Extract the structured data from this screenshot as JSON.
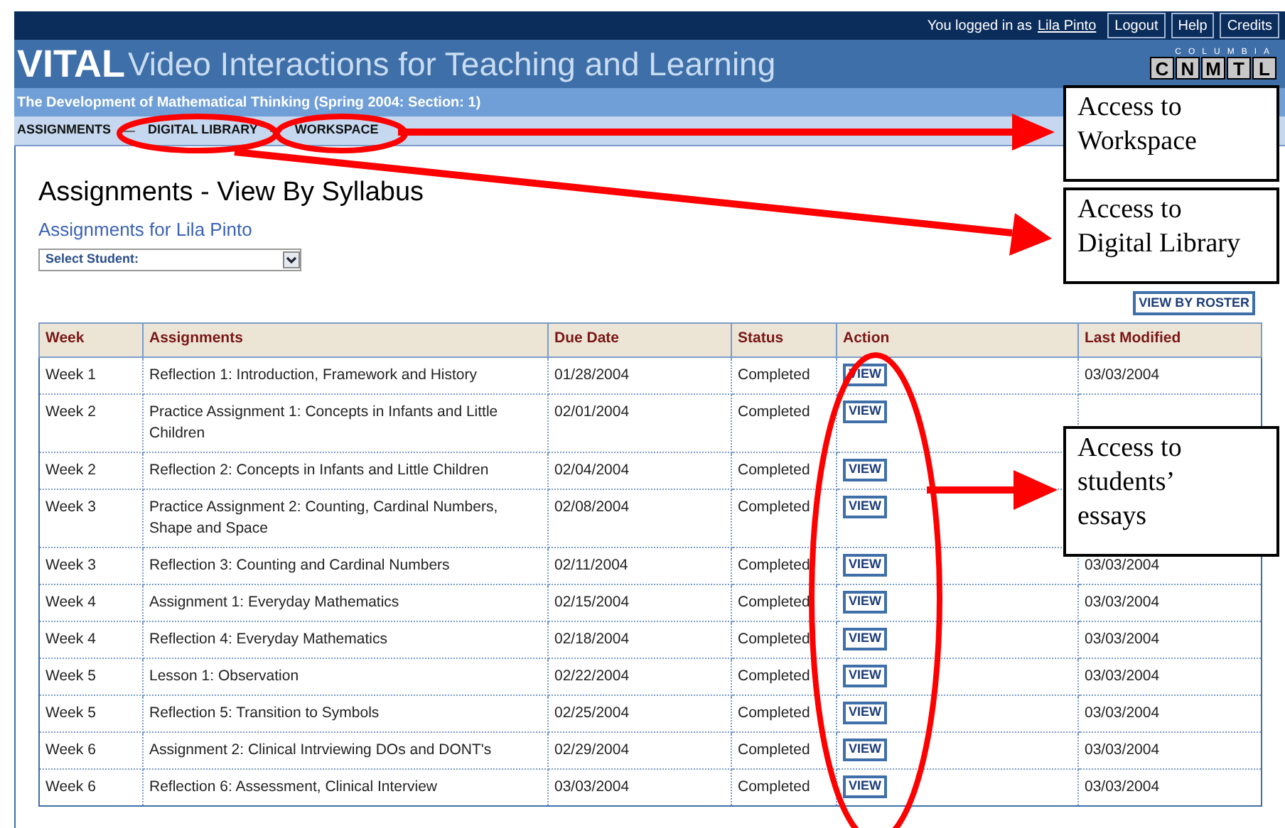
{
  "top_bar": {
    "login_text": "You logged in as",
    "user_link": "Lila Pinto",
    "buttons": [
      "Logout",
      "Help",
      "Credits"
    ]
  },
  "header": {
    "brand": "VITAL",
    "tagline": "Video Interactions for Teaching and Learning",
    "logo": {
      "top": "COLUMBIA",
      "letters": [
        "C",
        "N",
        "M",
        "T",
        "L"
      ]
    }
  },
  "course_title": "The Development of Mathematical Thinking (Spring 2004: Section: 1)",
  "nav": [
    {
      "label": "ASSIGNMENTS"
    },
    {
      "label": "DIGITAL LIBRARY"
    },
    {
      "label": "WORKSPACE"
    }
  ],
  "page_title": "Assignments - View By Syllabus",
  "subtitle": "Assignments for Lila Pinto",
  "student_select": {
    "value": "Select Student:"
  },
  "view_by_roster": "VIEW BY ROSTER",
  "table": {
    "columns": [
      "Week",
      "Assignments",
      "Due Date",
      "Status",
      "Action",
      "Last Modified"
    ],
    "rows": [
      {
        "week": "Week 1",
        "assignment": "Reflection 1: Introduction, Framework and History",
        "due": "01/28/2004",
        "status": "Completed",
        "action": "VIEW",
        "modified": "03/03/2004"
      },
      {
        "week": "Week 2",
        "assignment": "Practice Assignment 1: Concepts in Infants and Little Children",
        "due": "02/01/2004",
        "status": "Completed",
        "action": "VIEW"
      },
      {
        "week": "Week 2",
        "assignment": "Reflection 2: Concepts in Infants and Little Children",
        "due": "02/04/2004",
        "status": "Completed",
        "action": "VIEW"
      },
      {
        "week": "Week 3",
        "assignment": "Practice Assignment 2: Counting, Cardinal Numbers, Shape and Space",
        "due": "02/08/2004",
        "status": "Completed",
        "action": "VIEW"
      },
      {
        "week": "Week 3",
        "assignment": "Reflection 3: Counting and Cardinal Numbers",
        "due": "02/11/2004",
        "status": "Completed",
        "action": "VIEW",
        "modified": "03/03/2004"
      },
      {
        "week": "Week 4",
        "assignment": "Assignment 1: Everyday Mathematics",
        "due": "02/15/2004",
        "status": "Completed",
        "action": "VIEW",
        "modified": "03/03/2004"
      },
      {
        "week": "Week 4",
        "assignment": "Reflection 4: Everyday Mathematics",
        "due": "02/18/2004",
        "status": "Completed",
        "action": "VIEW",
        "modified": "03/03/2004"
      },
      {
        "week": "Week 5",
        "assignment": "Lesson 1: Observation",
        "due": "02/22/2004",
        "status": "Completed",
        "action": "VIEW",
        "modified": "03/03/2004"
      },
      {
        "week": "Week 5",
        "assignment": "Reflection 5: Transition to Symbols",
        "due": "02/25/2004",
        "status": "Completed",
        "action": "VIEW",
        "modified": "03/03/2004"
      },
      {
        "week": "Week 6",
        "assignment": "Assignment 2: Clinical Intrviewing DOs and DONT's",
        "due": "02/29/2004",
        "status": "Completed",
        "action": "VIEW",
        "modified": "03/03/2004"
      },
      {
        "week": "Week 6",
        "assignment": "Reflection 6: Assessment, Clinical Interview",
        "due": "03/03/2004",
        "status": "Completed",
        "action": "VIEW",
        "modified": "03/03/2004"
      }
    ]
  },
  "annotations": {
    "callouts": [
      {
        "lines": [
          "Access to",
          "Workspace"
        ]
      },
      {
        "lines": [
          "Access to",
          "Digital Library"
        ]
      },
      {
        "lines": [
          "Access to",
          "students’",
          "essays"
        ]
      }
    ]
  }
}
